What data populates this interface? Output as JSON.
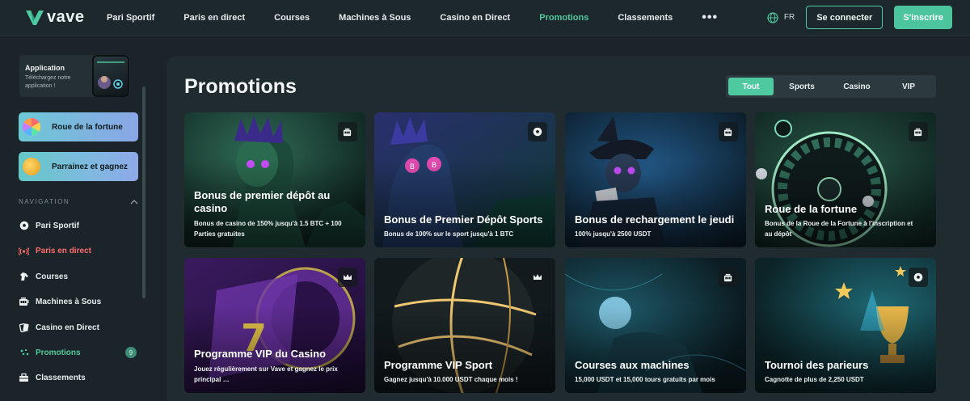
{
  "brand": {
    "name": "vave",
    "accent": "#4fc9a0"
  },
  "topnav": {
    "links": [
      "Pari Sportif",
      "Paris en direct",
      "Courses",
      "Machines à Sous",
      "Casino en Direct",
      "Promotions",
      "Classements"
    ],
    "active": "Promotions",
    "more_icon": "ellipsis-icon",
    "language": "FR",
    "login_label": "Se connecter",
    "signup_label": "S'inscrire"
  },
  "sidebar": {
    "app": {
      "title": "Application",
      "subtitle": "Téléchargez notre application !"
    },
    "wheel_label": "Roue de la fortune",
    "referral_label": "Parrainez et gagnez",
    "nav_header": "NAVIGATION",
    "items": [
      {
        "label": "Pari Sportif",
        "icon": "soccer-ball-icon"
      },
      {
        "label": "Paris en direct",
        "icon": "live-signal-icon"
      },
      {
        "label": "Courses",
        "icon": "horse-icon"
      },
      {
        "label": "Machines à Sous",
        "icon": "slot-machine-icon"
      },
      {
        "label": "Casino en Direct",
        "icon": "cards-icon"
      },
      {
        "label": "Promotions",
        "icon": "gift-icon",
        "badge": "9"
      },
      {
        "label": "Classements",
        "icon": "trophy-icon"
      }
    ]
  },
  "main": {
    "title": "Promotions",
    "filters": [
      "Tout",
      "Sports",
      "Casino",
      "VIP"
    ],
    "active_filter": "Tout",
    "cards": [
      {
        "title_lines": [
          "Bonus de premier dépôt au",
          "casino"
        ],
        "desc_lines": [
          "Bonus de casino de 150% jusqu'à 1.5 BTC + 100",
          "Parties gratuites"
        ],
        "icon": "slot-machine-icon"
      },
      {
        "title_lines": [
          "Bonus de Premier Dépôt Sports"
        ],
        "desc_lines": [
          "Bonus de 100% sur le sport jusqu'à 1 BTC"
        ],
        "icon": "soccer-ball-icon"
      },
      {
        "title_lines": [
          "Bonus de rechargement le jeudi"
        ],
        "desc_lines": [
          "100% jusqu'à 2500 USDT"
        ],
        "icon": "slot-machine-icon"
      },
      {
        "title_lines": [
          "Roue de la fortune"
        ],
        "desc_lines": [
          "Bonus de la Roue de la Fortune à l'inscription et",
          "au dépôt"
        ],
        "icon": "slot-machine-icon"
      },
      {
        "title_lines": [
          "Programme VIP du Casino"
        ],
        "desc_lines": [
          "Jouez régulièrement sur Vave et gagnez le prix",
          "principal …"
        ],
        "icon": "crown-icon"
      },
      {
        "title_lines": [
          "Programme VIP Sport"
        ],
        "desc_lines": [
          "Gagnez jusqu'à 10.000 USDT chaque mois !"
        ],
        "icon": "crown-icon"
      },
      {
        "title_lines": [
          "Courses aux machines"
        ],
        "desc_lines": [
          "15,000 USDT et 15,000 tours gratuits par mois"
        ],
        "icon": "slot-machine-icon"
      },
      {
        "title_lines": [
          "Tournoi des parieurs"
        ],
        "desc_lines": [
          "Cagnotte de plus de 2,250 USDT"
        ],
        "icon": "soccer-ball-icon"
      }
    ]
  }
}
